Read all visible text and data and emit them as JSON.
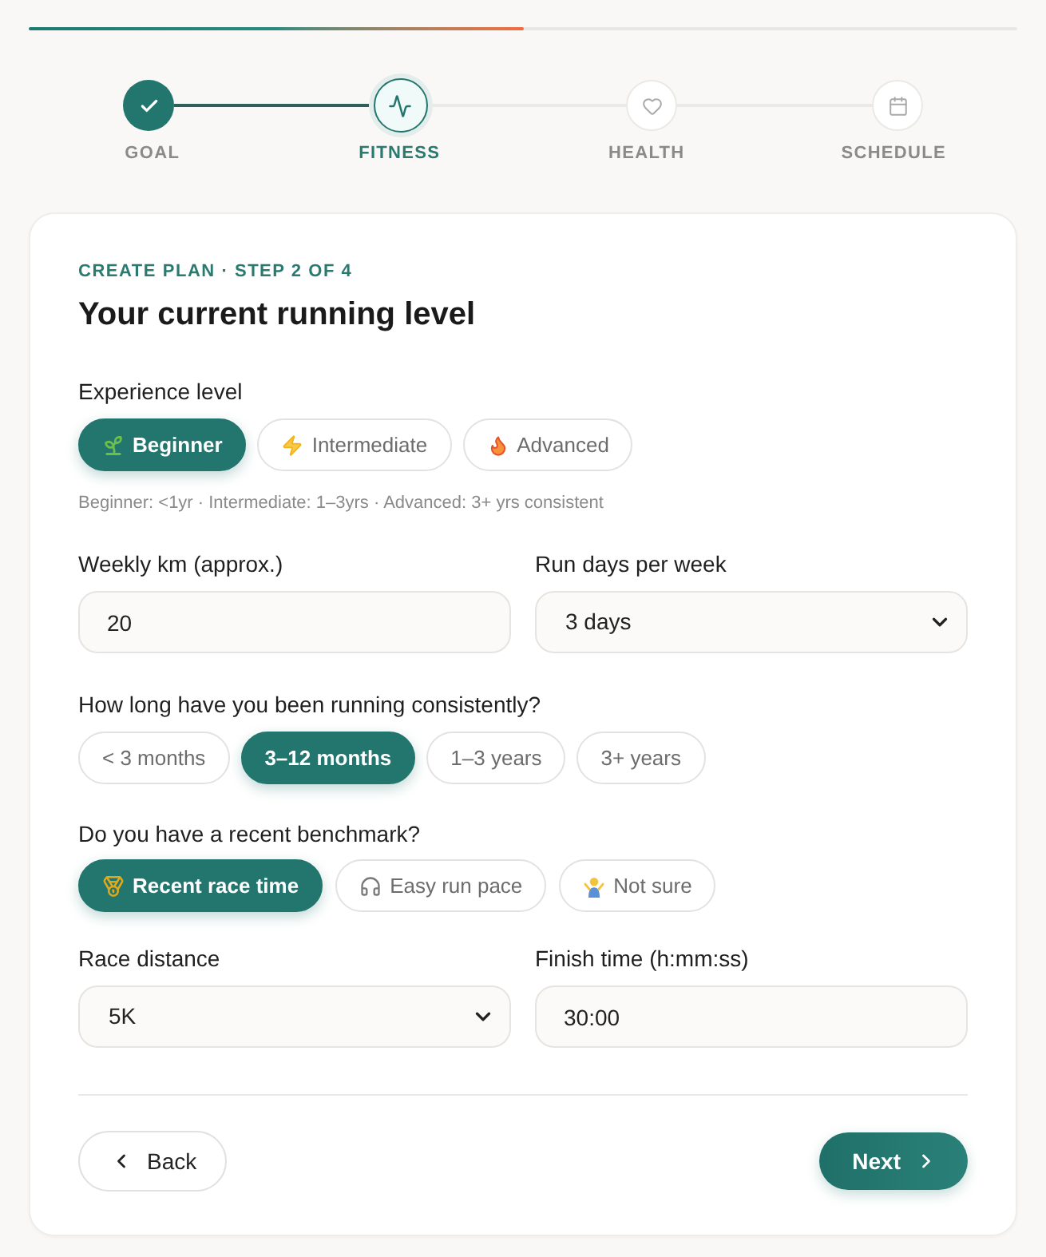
{
  "progress": {
    "level": 0.5
  },
  "steps": [
    {
      "label": "GOAL",
      "done": true,
      "selected": false
    },
    {
      "label": "FITNESS",
      "done": false,
      "selected": true
    },
    {
      "label": "HEALTH",
      "done": false,
      "selected": false
    },
    {
      "label": "SCHEDULE",
      "done": false,
      "selected": false
    }
  ],
  "card": {
    "eyebrow": "CREATE PLAN · STEP 2 OF 4",
    "title": "Your current running level"
  },
  "experience": {
    "label": "Experience level",
    "options": [
      {
        "label": "Beginner",
        "selected": true
      },
      {
        "label": "Intermediate",
        "selected": false
      },
      {
        "label": "Advanced",
        "selected": false
      }
    ],
    "hint": "Beginner: <1yr · Intermediate: 1–3yrs · Advanced: 3+ yrs consistent"
  },
  "weekly_km": {
    "label": "Weekly km (approx.)",
    "value": "20"
  },
  "run_days": {
    "label": "Run days per week",
    "value": "3 days"
  },
  "consistency": {
    "label": "How long have you been running consistently?",
    "options": [
      {
        "label": "< 3 months",
        "selected": false
      },
      {
        "label": "3–12 months",
        "selected": true
      },
      {
        "label": "1–3 years",
        "selected": false
      },
      {
        "label": "3+ years",
        "selected": false
      }
    ]
  },
  "benchmark": {
    "label": "Do you have a recent benchmark?",
    "options": [
      {
        "label": "Recent race time",
        "selected": true
      },
      {
        "label": "Easy run pace",
        "selected": false
      },
      {
        "label": "Not sure",
        "selected": false
      }
    ]
  },
  "race_distance": {
    "label": "Race distance",
    "value": "5K"
  },
  "finish_time": {
    "label": "Finish time (h:mm:ss)",
    "value": "30:00"
  },
  "buttons": {
    "back": "Back",
    "next": "Next"
  }
}
